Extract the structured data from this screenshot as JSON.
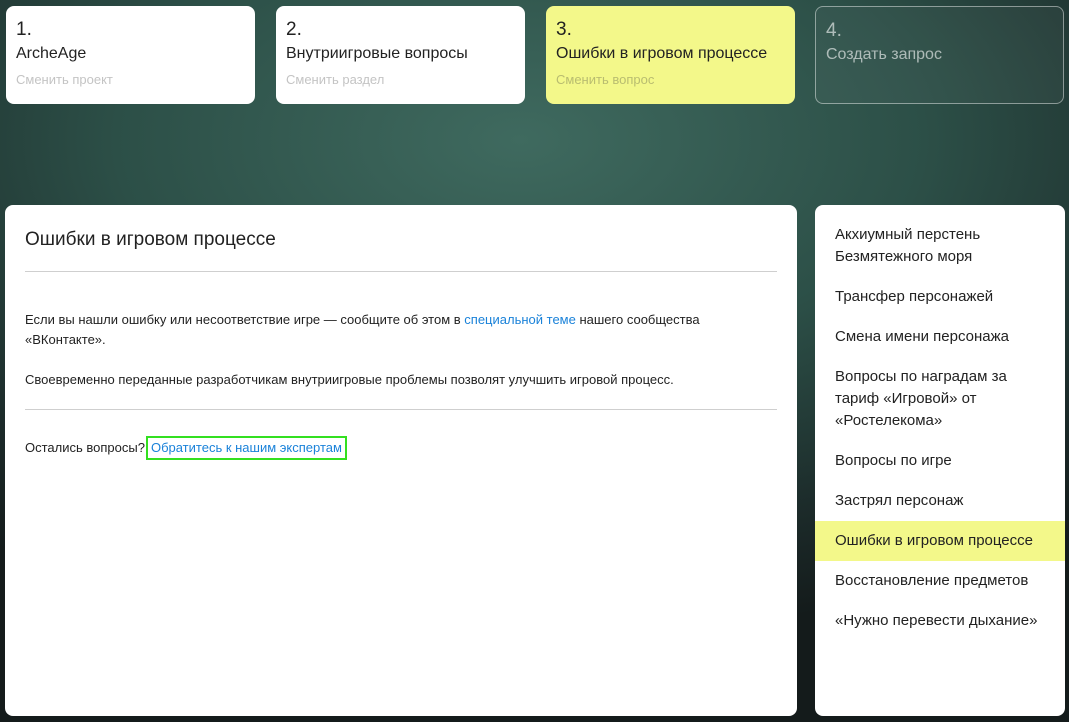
{
  "steps": [
    {
      "num": "1.",
      "title": "ArcheAge",
      "sub": "Сменить проект"
    },
    {
      "num": "2.",
      "title": "Внутриигровые вопросы",
      "sub": "Сменить раздел"
    },
    {
      "num": "3.",
      "title": "Ошибки в игровом процессе",
      "sub": "Сменить вопрос"
    },
    {
      "num": "4.",
      "title": "Создать запрос"
    }
  ],
  "main": {
    "title": "Ошибки в игровом процессе",
    "para1_before": "Если вы нашли ошибку или несоответствие игре — сообщите об этом в ",
    "para1_link": "специальной теме",
    "para1_after": " нашего сообщества «ВКонтакте».",
    "para2": "Своевременно переданные разработчикам внутриигровые проблемы позволят улучшить игровой процесс.",
    "questions_text": "Остались вопросы?",
    "experts_link": "Обратитесь к нашим экспертам"
  },
  "sidebar": {
    "items": [
      {
        "label": "Акхиумный перстень Безмятежного моря"
      },
      {
        "label": "Трансфер персонажей"
      },
      {
        "label": "Смена имени персонажа"
      },
      {
        "label": "Вопросы по наградам за тариф «Игровой» от «Ростелекома»"
      },
      {
        "label": "Вопросы по игре"
      },
      {
        "label": "Застрял персонаж"
      },
      {
        "label": "Ошибки в игровом процессе",
        "active": true
      },
      {
        "label": "Восстановление предметов"
      },
      {
        "label": "«Нужно перевести дыхание»"
      }
    ]
  },
  "colors": {
    "accent": "#f3f88a",
    "link": "#1a82d9",
    "highlight_border": "#33e020"
  }
}
